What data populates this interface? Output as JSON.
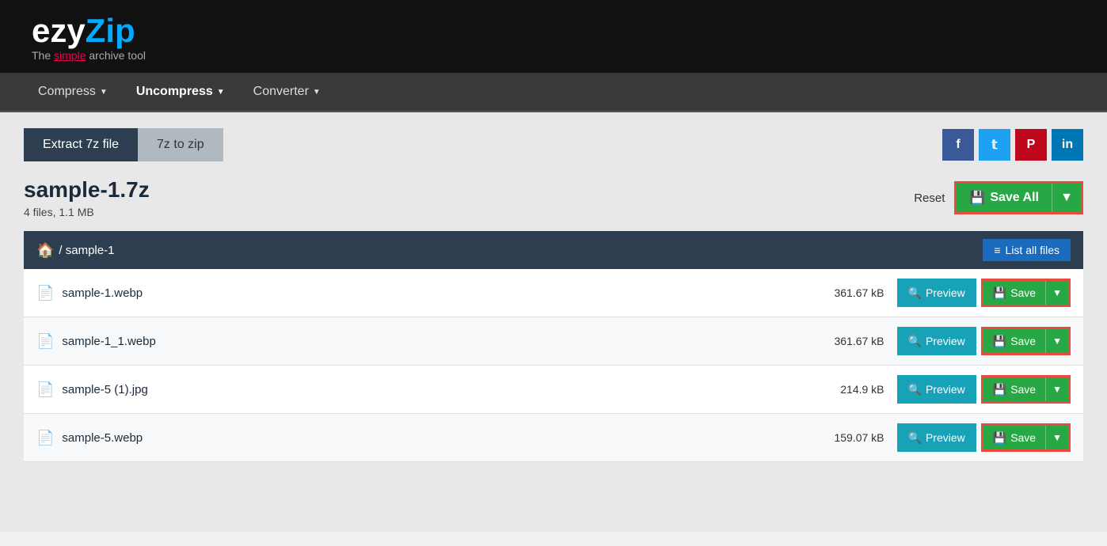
{
  "header": {
    "logo_ezy": "ezy",
    "logo_zip": "Zip",
    "tagline_before": "The ",
    "tagline_simple": "simple",
    "tagline_after": " archive tool"
  },
  "nav": {
    "items": [
      {
        "label": "Compress",
        "has_dropdown": true
      },
      {
        "label": "Uncompress",
        "has_dropdown": true
      },
      {
        "label": "Converter",
        "has_dropdown": true
      }
    ]
  },
  "tabs": [
    {
      "label": "Extract 7z file",
      "active": true
    },
    {
      "label": "7z to zip",
      "active": false
    }
  ],
  "social": [
    {
      "label": "f",
      "name": "facebook",
      "class": "social-fb"
    },
    {
      "label": "t",
      "name": "twitter",
      "class": "social-tw"
    },
    {
      "label": "P",
      "name": "pinterest",
      "class": "social-pi"
    },
    {
      "label": "in",
      "name": "linkedin",
      "class": "social-li"
    }
  ],
  "file_info": {
    "title": "sample-1.7z",
    "meta": "4 files, 1.1 MB",
    "reset_label": "Reset",
    "save_all_label": "Save All"
  },
  "breadcrumb": {
    "path": "/ sample-1",
    "list_all_label": "List all files"
  },
  "files": [
    {
      "name": "sample-1.webp",
      "size": "361.67 kB"
    },
    {
      "name": "sample-1_1.webp",
      "size": "361.67 kB"
    },
    {
      "name": "sample-5 (1).jpg",
      "size": "214.9 kB"
    },
    {
      "name": "sample-5.webp",
      "size": "159.07 kB"
    }
  ],
  "buttons": {
    "preview_label": "Preview",
    "save_label": "Save"
  }
}
